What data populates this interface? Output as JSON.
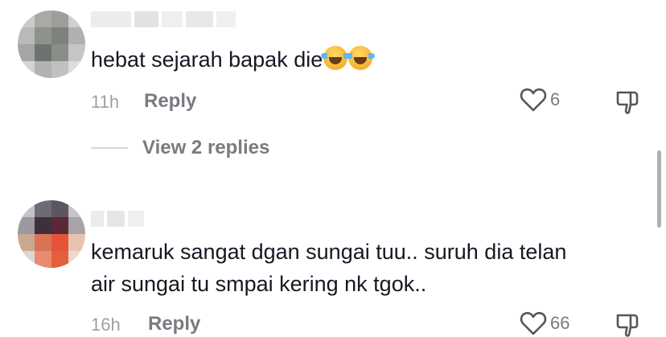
{
  "comments": [
    {
      "text": "hebat sejarah bapak die",
      "emojis": [
        "face-with-tears-of-joy",
        "face-with-tears-of-joy"
      ],
      "time": "11h",
      "reply_label": "Reply",
      "likes": "6",
      "view_replies_label": "View 2 replies"
    },
    {
      "text_line1": "kemaruk sangat dgan sungai tuu.. suruh dia telan",
      "text_line2": "air sungai tu smpai kering nk tgok..",
      "time": "16h",
      "reply_label": "Reply",
      "likes": "66"
    }
  ],
  "colors": {
    "text": "#161823",
    "meta": "#a0a0a6",
    "action": "#7a7a80",
    "icon": "#55555b"
  }
}
